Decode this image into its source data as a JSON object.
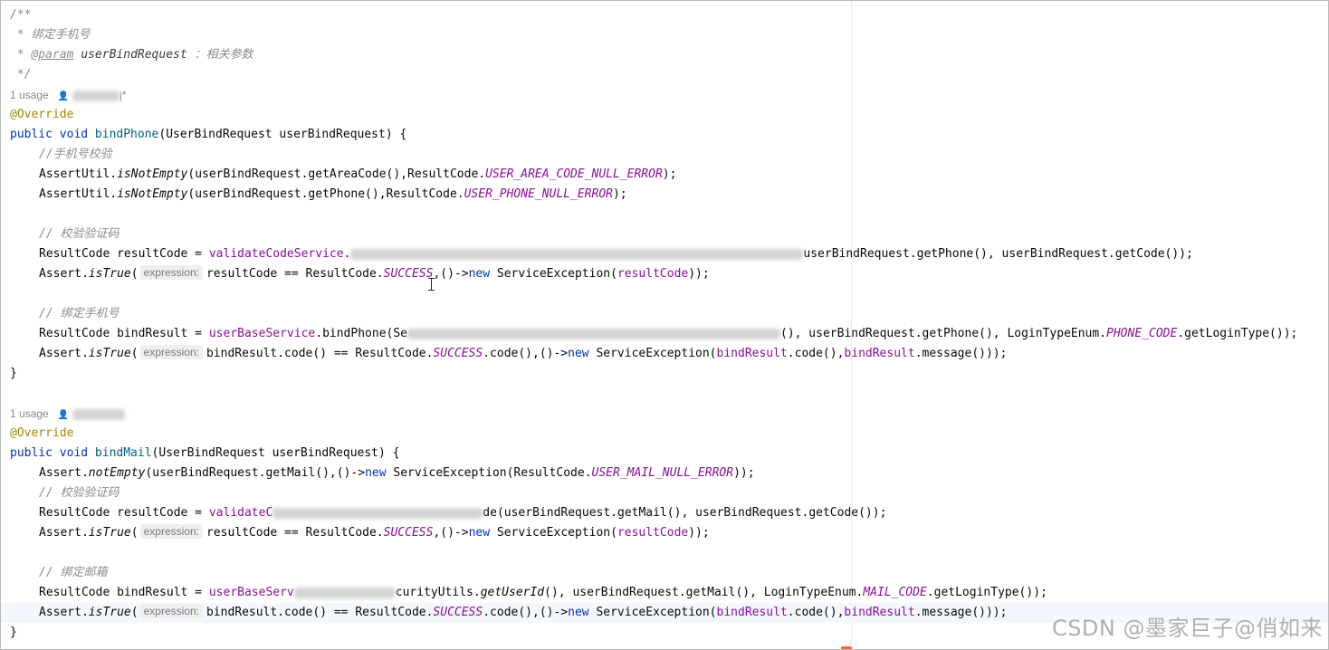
{
  "doc1": {
    "open": "/**",
    "desc": " * 绑定手机号",
    "param_prefix": " * ",
    "param_tag": "@param",
    "param_name": " userBindRequest ",
    "param_desc": "：相关参数",
    "close": " */"
  },
  "method1": {
    "usage": "1 usage",
    "author_suffix": "j*",
    "annotation": "@Override",
    "sig_kw": "public void ",
    "sig_name": "bindPhone",
    "sig_rest": "(UserBindRequest userBindRequest) {",
    "c1": "//手机号校验",
    "l1": {
      "a": "AssertUtil.",
      "fn": "isNotEmpty",
      "b": "(userBindRequest.getAreaCode(),ResultCode.",
      "const": "USER_AREA_CODE_NULL_ERROR",
      "c": ");"
    },
    "l2": {
      "a": "AssertUtil.",
      "fn": "isNotEmpty",
      "b": "(userBindRequest.getPhone(),ResultCode.",
      "const": "USER_PHONE_NULL_ERROR",
      "c": ");"
    },
    "c2": "// 校验验证码",
    "l3": {
      "a": "ResultCode resultCode = ",
      "fld": "validateCodeService",
      "dot": ".",
      "tail": "userBindRequest.getPhone(), userBindRequest.getCode());"
    },
    "l4": {
      "a": "Assert.",
      "fn": "isTrue",
      "open": "(",
      "hint": "expression:",
      "b": "resultCode == ResultCode.",
      "const": "SUCCESS",
      "c": ",()->",
      "kw": "new",
      "d": " ServiceException(",
      "fld": "resultCode",
      "e": "));"
    },
    "c3": "// 绑定手机号",
    "l5": {
      "a": "ResultCode bindResult = ",
      "fld": "userBaseService",
      "b": ".bindPhone(Se",
      "c": "(), userBindRequest.getPhone(), LoginTypeEnum.",
      "const": "PHONE_CODE",
      "d": ".getLoginType());"
    },
    "l6": {
      "a": "Assert.",
      "fn": "isTrue",
      "open": "(",
      "hint": "expression:",
      "b": "bindResult.code() == ResultCode.",
      "const": "SUCCESS",
      "c": ".code(),()->",
      "kw": "new",
      "d": " ServiceException(",
      "fld1": "bindResult",
      "e": ".code(),",
      "fld2": "bindResult",
      "f": ".message()));"
    },
    "end": "}"
  },
  "method2": {
    "usage": "1 usage",
    "annotation": "@Override",
    "sig_kw": "public void ",
    "sig_name": "bindMail",
    "sig_rest": "(UserBindRequest userBindRequest) {",
    "l1": {
      "a": "Assert.",
      "fn": "notEmpty",
      "b": "(userBindRequest.getMail(),()->",
      "kw": "new",
      "c": " ServiceException(ResultCode.",
      "const": "USER_MAIL_NULL_ERROR",
      "d": "));"
    },
    "c1": "// 校验验证码",
    "l2": {
      "a": "ResultCode resultCode = ",
      "fld": "validateC",
      "tail": "de(userBindRequest.getMail(), userBindRequest.getCode());"
    },
    "l3": {
      "a": "Assert.",
      "fn": "isTrue",
      "open": "(",
      "hint": "expression:",
      "b": "resultCode == ResultCode.",
      "const": "SUCCESS",
      "c": ",()->",
      "kw": "new",
      "d": " ServiceException(",
      "fld": "resultCode",
      "e": "));"
    },
    "c2": "// 绑定邮箱",
    "l4": {
      "a": "ResultCode bindResult = ",
      "fld": "userBaseServ",
      "b": "curityUtils.",
      "fn": "getUserId",
      "c": "(), userBindRequest.getMail(), LoginTypeEnum.",
      "const": "MAIL_CODE",
      "d": ".getLoginType());"
    },
    "l5": {
      "a": "Assert.",
      "fn": "isTrue",
      "open": "(",
      "hint": "expression:",
      "b": "bindResult.code() == ResultCode.",
      "const": "SUCCESS",
      "c": ".code(),()->",
      "kw": "new",
      "d": " ServiceException(",
      "fld1": "bindResult",
      "e": ".code(),",
      "fld2": "bindResult",
      "f": ".message()));"
    },
    "end": "}"
  },
  "watermark": "CSDN @墨家巨子@俏如来"
}
